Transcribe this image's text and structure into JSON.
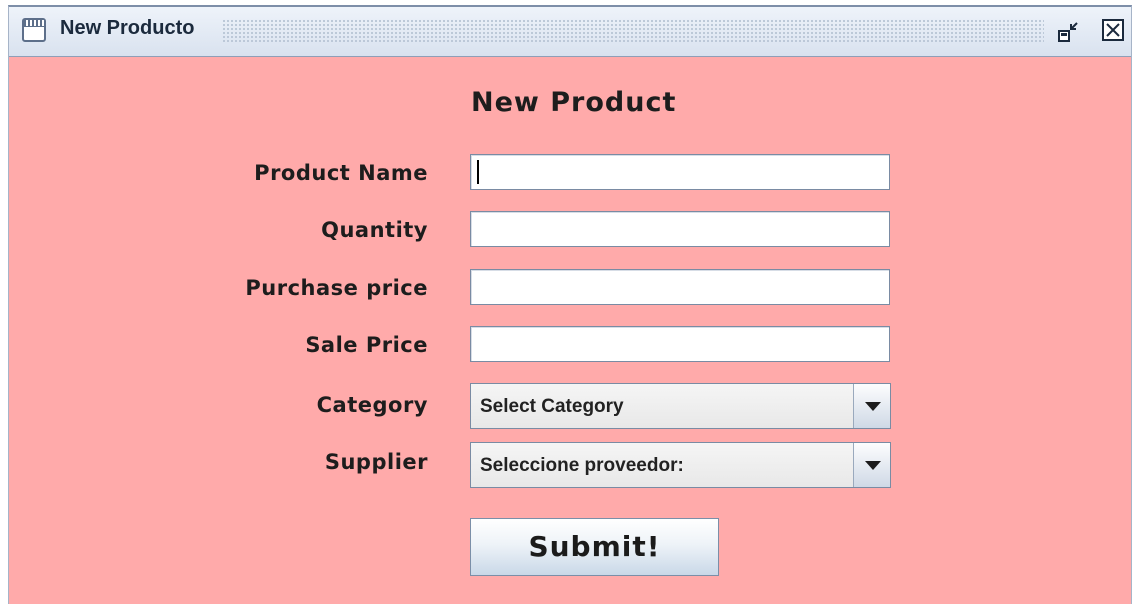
{
  "window": {
    "title": "New Producto",
    "icon": "window-icon",
    "controls": {
      "iconify_icon": "restore-icon",
      "close_icon": "close-icon"
    },
    "background_color": "#ffaaaa"
  },
  "form": {
    "title": "New Product",
    "fields": {
      "product_name": {
        "label": "Product Name",
        "value": ""
      },
      "quantity": {
        "label": "Quantity",
        "value": ""
      },
      "purchase_price": {
        "label": "Purchase price",
        "value": ""
      },
      "sale_price": {
        "label": "Sale Price",
        "value": ""
      }
    },
    "category": {
      "label": "Category",
      "selected": "Select Category"
    },
    "supplier": {
      "label": "Supplier",
      "selected": "Seleccione proveedor:"
    },
    "submit_label": "Submit!"
  }
}
